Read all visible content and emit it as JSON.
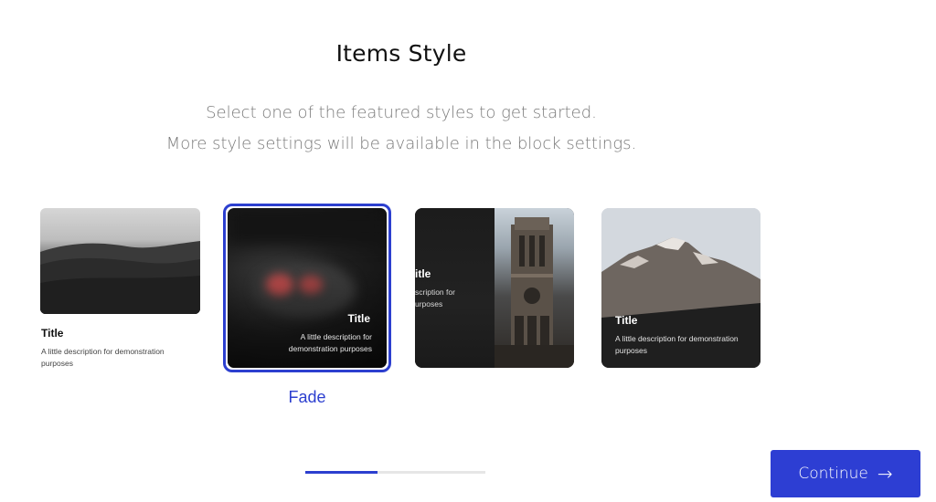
{
  "header": {
    "title": "Items Style",
    "subtitle_line1": "Select one of the featured styles to get started.",
    "subtitle_line2": "More style settings will be available in the block settings."
  },
  "cards": [
    {
      "style": "standard",
      "title": "Title",
      "description": "A little description for demonstration purposes"
    },
    {
      "style": "fade",
      "title": "Title",
      "description": "A little description for demonstration purposes",
      "selected": true
    },
    {
      "style": "split",
      "title": "itle",
      "description": "scription for\nurposes"
    },
    {
      "style": "overlay",
      "title": "Title",
      "description": "A little description for demonstration purposes"
    }
  ],
  "selected_style_label": "Fade",
  "progress": {
    "fraction": 0.4
  },
  "continue_button": {
    "label": "Continue",
    "icon": "arrow-right-icon"
  },
  "colors": {
    "accent": "#2c3fcf",
    "button": "#2d3ed3"
  }
}
